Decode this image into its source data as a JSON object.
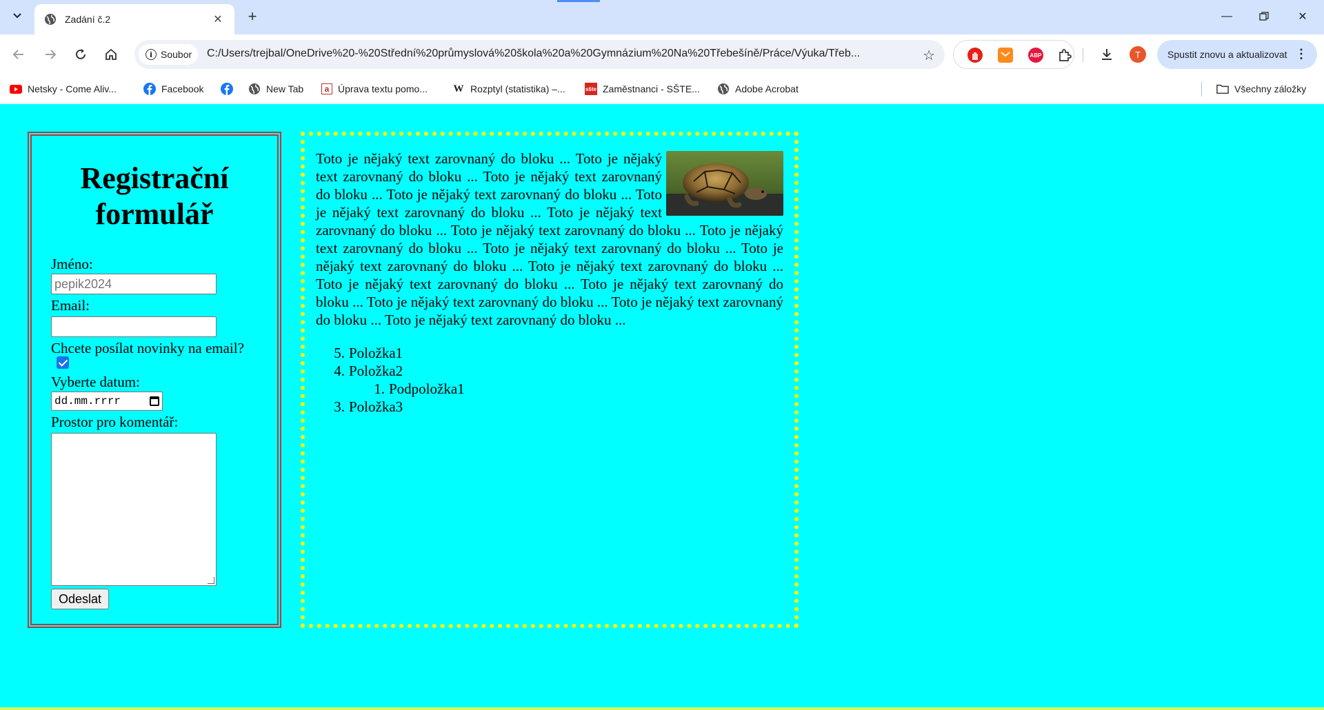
{
  "browser": {
    "tab_title": "Zadání č.2",
    "new_tab_symbol": "+",
    "site_chip_label": "Soubor",
    "url": "C:/Users/trejbal/OneDrive%20-%20Střední%20průmyslová%20škola%20a%20Gymnázium%20Na%20Třebešíně/Práce/Výuka/Třeb...",
    "update_button_label": "Spustit znovu a aktualizovat",
    "profile_initial": "T",
    "bookmarks": [
      {
        "label": "Netsky - Come Aliv...",
        "icon": "youtube-icon"
      },
      {
        "label": "Facebook",
        "icon": "facebook-icon"
      },
      {
        "label": "",
        "icon": "facebook-icon"
      },
      {
        "label": "New Tab",
        "icon": "globe-icon"
      },
      {
        "label": "Úprava textu pomo...",
        "icon": "document-icon"
      },
      {
        "label": "Rozptyl (statistika) –...",
        "icon": "wikipedia-icon"
      },
      {
        "label": "Zaměstnanci - SŠTE...",
        "icon": "sste-icon"
      },
      {
        "label": "Adobe Acrobat",
        "icon": "globe-icon"
      }
    ],
    "all_bookmarks_label": "Všechny záložky",
    "accent_color": "#d3e3fd"
  },
  "page": {
    "background_color": "#00ffff",
    "form": {
      "title": "Registrační formulář",
      "name_label": "Jméno:",
      "name_placeholder": "pepik2024",
      "email_label": "Email:",
      "email_value": "",
      "newsletter_label": "Chcete posílat novinky na email?",
      "newsletter_checked": true,
      "date_label": "Vyberte datum:",
      "date_placeholder": "dd.mm.rrrr",
      "comment_label": "Prostor pro komentář:",
      "comment_value": "",
      "submit_label": "Odeslat",
      "border_color": "#b53a3a"
    },
    "content": {
      "paragraph": "Toto je nějaký text zarovnaný do bloku ... Toto je nějaký text zarovnaný do bloku ... Toto je nějaký text zarovnaný do bloku ... Toto je nějaký text zarovnaný do bloku ... Toto je nějaký text zarovnaný do bloku ... Toto je nějaký text zarovnaný do bloku ... Toto je nějaký text zarovnaný do bloku ... Toto je nějaký text zarovnaný do bloku ... Toto je nějaký text zarovnaný do bloku ... Toto je nějaký text zarovnaný do bloku ... Toto je nějaký text zarovnaný do bloku ... Toto je nějaký text zarovnaný do bloku ... Toto je nějaký text zarovnaný do bloku ... Toto je nějaký text zarovnaný do bloku ... Toto je nějaký text zarovnaný do bloku ... Toto je nějaký text zarovnaný do bloku ...",
      "image": "turtle-photo",
      "border_color": "#ffff00",
      "list": [
        {
          "number": "5.",
          "label": "Položka1"
        },
        {
          "number": "4.",
          "label": "Položka2"
        },
        {
          "number": "1.",
          "label": "Podpoložka1",
          "nested": true
        },
        {
          "number": "3.",
          "label": "Položka3"
        }
      ]
    }
  }
}
